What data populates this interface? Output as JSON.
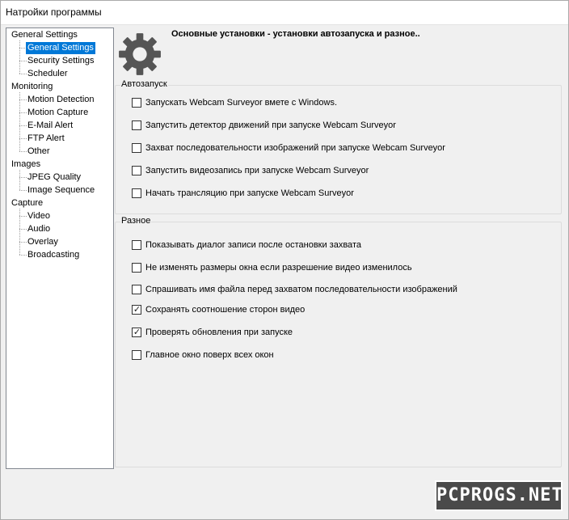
{
  "window": {
    "title": "Натройки программы"
  },
  "tree": {
    "categories": [
      {
        "label": "General Settings",
        "children": [
          {
            "label": "General Settings",
            "selected": true
          },
          {
            "label": "Security Settings"
          },
          {
            "label": "Scheduler"
          }
        ]
      },
      {
        "label": "Monitoring",
        "children": [
          {
            "label": "Motion Detection"
          },
          {
            "label": "Motion Capture"
          },
          {
            "label": "E-Mail Alert"
          },
          {
            "label": "FTP Alert"
          },
          {
            "label": "Other"
          }
        ]
      },
      {
        "label": "Images",
        "children": [
          {
            "label": "JPEG Quality"
          },
          {
            "label": "Image Sequence"
          }
        ]
      },
      {
        "label": "Capture",
        "children": [
          {
            "label": "Video"
          },
          {
            "label": "Audio"
          },
          {
            "label": "Overlay"
          },
          {
            "label": "Broadcasting"
          }
        ]
      }
    ]
  },
  "panel": {
    "header": "Основные установки - установки автозапуска и разное..",
    "header_icon": "gear-icon",
    "groups": [
      {
        "title": "Автозапуск",
        "items": [
          {
            "label": "Запускать Webcam Surveyor вмете с Windows.",
            "checked": false
          },
          {
            "label": "Запустить детектор движений при запуске Webcam Surveyor",
            "checked": false
          },
          {
            "label": "Захват последовательности изображений при запуске Webcam Surveyor",
            "checked": false
          },
          {
            "label": "Запустить видеозапись при запуске Webcam Surveyor",
            "checked": false
          },
          {
            "label": "Начать трансляцию при запуске Webcam Surveyor",
            "checked": false
          }
        ]
      },
      {
        "title": "Разное",
        "items": [
          {
            "label": "Показывать диалог записи после остановки захвата",
            "checked": false
          },
          {
            "label": "Не изменять размеры окна если разрешение видео изменилось",
            "checked": false
          },
          {
            "label": "Спрашивать имя файла перед захватом последовательности изображений",
            "checked": false
          },
          {
            "label": "Сохранять соотношение сторон видео",
            "checked": true
          },
          {
            "label": "Проверять обновления при запуске",
            "checked": true
          },
          {
            "label": "Главное окно поверх всех окон",
            "checked": false
          }
        ]
      }
    ]
  },
  "watermark": {
    "text": "PCPROGS.NET"
  },
  "colors": {
    "selection": "#0078d7",
    "background": "#f0f0f0",
    "tree_background": "#ffffff"
  }
}
